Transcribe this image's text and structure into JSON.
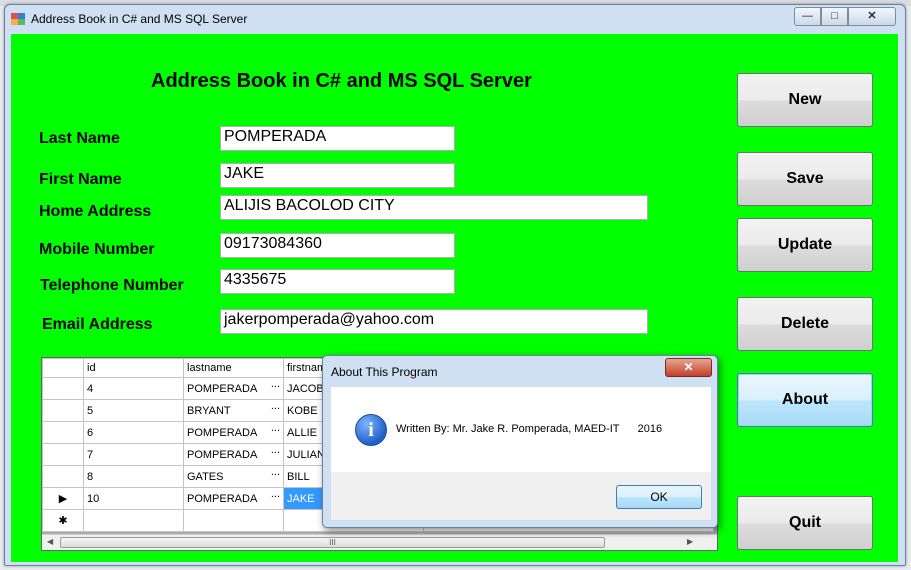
{
  "window": {
    "title": "Address Book in C# and MS SQL Server",
    "minimize": "—",
    "maximize": "□",
    "close": "✕"
  },
  "form": {
    "heading": "Address Book in C# and MS SQL Server",
    "fields": {
      "last_name": {
        "label": "Last Name",
        "value": "POMPERADA"
      },
      "first_name": {
        "label": "First Name",
        "value": "JAKE"
      },
      "home_address": {
        "label": "Home Address",
        "value": "ALIJIS BACOLOD CITY"
      },
      "mobile_number": {
        "label": "Mobile Number",
        "value": "09173084360"
      },
      "telephone_number": {
        "label": "Telephone Number",
        "value": "4335675"
      },
      "email_address": {
        "label": "Email Address",
        "value": "jakerpomperada@yahoo.com"
      }
    }
  },
  "buttons": {
    "new": "New",
    "save": "Save",
    "update": "Update",
    "delete": "Delete",
    "about": "About",
    "quit": "Quit"
  },
  "grid": {
    "columns": [
      "id",
      "lastname",
      "firstnam"
    ],
    "rows": [
      {
        "indicator": "",
        "id": "4",
        "lastname": "POMPERADA",
        "firstname": "JACOB"
      },
      {
        "indicator": "",
        "id": "5",
        "lastname": "BRYANT",
        "firstname": "KOBE"
      },
      {
        "indicator": "",
        "id": "6",
        "lastname": "POMPERADA",
        "firstname": "ALLIE"
      },
      {
        "indicator": "",
        "id": "7",
        "lastname": "POMPERADA",
        "firstname": "JULIAN"
      },
      {
        "indicator": "",
        "id": "8",
        "lastname": "GATES",
        "firstname": "BILL"
      },
      {
        "indicator": "▶",
        "id": "10",
        "lastname": "POMPERADA",
        "firstname": "JAKE"
      }
    ],
    "new_row_indicator": "✱",
    "ellipsis": "...",
    "scroll_grip": "III",
    "scroll_left": "◀",
    "scroll_right": "▶"
  },
  "dialog": {
    "title": "About This Program",
    "close": "✕",
    "icon": "i",
    "message": "Written By: Mr. Jake R. Pomperada, MAED-IT      2016",
    "ok": "OK"
  }
}
